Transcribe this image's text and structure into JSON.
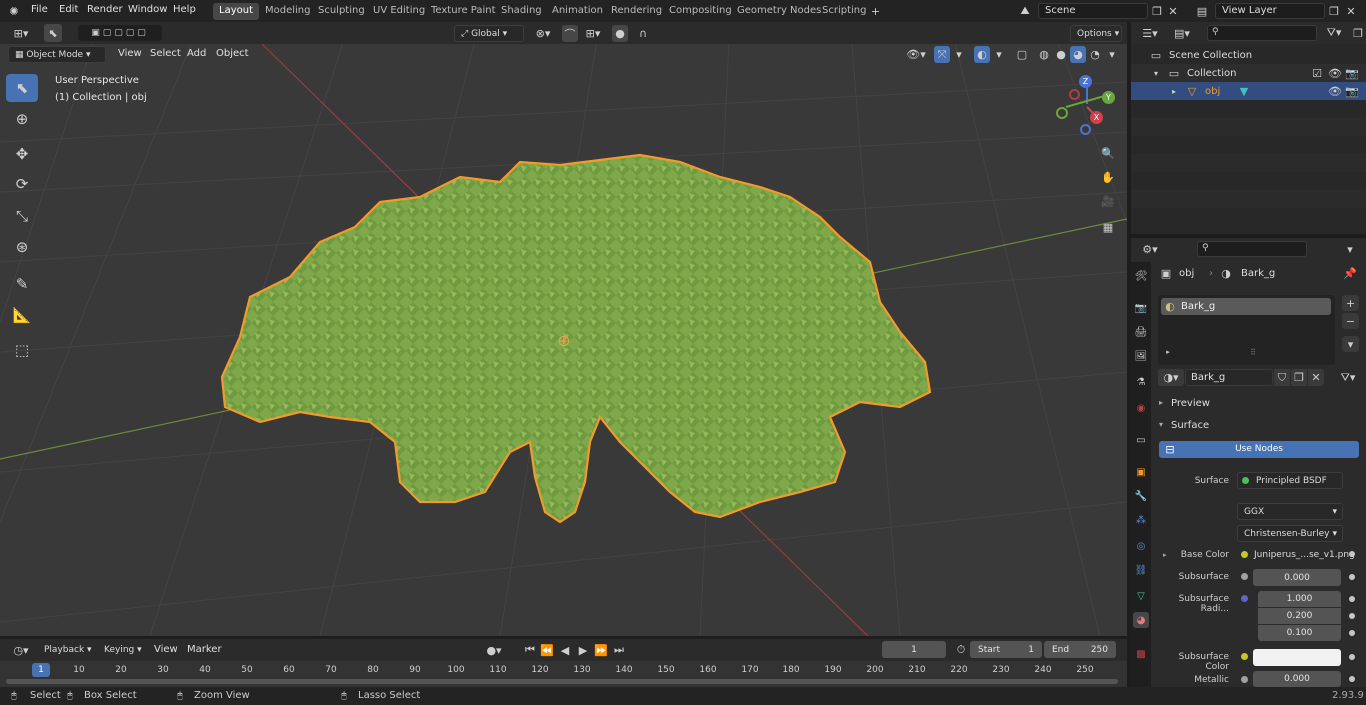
{
  "menu": [
    "File",
    "Edit",
    "Render",
    "Window",
    "Help"
  ],
  "workspaces": [
    "Layout",
    "Modeling",
    "Sculpting",
    "UV Editing",
    "Texture Paint",
    "Shading",
    "Animation",
    "Rendering",
    "Compositing",
    "Geometry Nodes",
    "Scripting"
  ],
  "scene": "Scene",
  "view_layer": "View Layer",
  "header": {
    "orientation": "Global",
    "options": "Options"
  },
  "viewport": {
    "mode": "Object Mode",
    "menus": [
      "View",
      "Select",
      "Add",
      "Object"
    ],
    "perspective": "User Perspective",
    "collection_info": "(1) Collection | obj",
    "axes": {
      "z": "Z",
      "y": "Y",
      "x": "X"
    }
  },
  "outliner": {
    "scene_collection": "Scene Collection",
    "collection": "Collection",
    "object": "obj"
  },
  "properties": {
    "breadcrumb_obj": "obj",
    "breadcrumb_mat": "Bark_g",
    "slot": "Bark_g",
    "material_name": "Bark_g",
    "panel_preview": "Preview",
    "panel_surface": "Surface",
    "use_nodes": "Use Nodes",
    "surface_label": "Surface",
    "surface_value": "Principled BSDF",
    "distribution": "GGX",
    "subsurface_method": "Christensen-Burley",
    "base_color_label": "Base Color",
    "base_color_value": "Juniperus_...se_v1.png",
    "subsurface_label": "Subsurface",
    "subsurface_value": "0.000",
    "subsurface_radius_label": "Subsurface Radi...",
    "subsurface_radius": [
      "1.000",
      "0.200",
      "0.100"
    ],
    "subsurface_color_label": "Subsurface Color",
    "metallic_label": "Metallic",
    "metallic_value": "0.000"
  },
  "timeline": {
    "menus": [
      "Playback",
      "Keying",
      "View",
      "Marker"
    ],
    "current_frame": "1",
    "start_label": "Start",
    "start": "1",
    "end_label": "End",
    "end": "250",
    "frames": [
      "1",
      "10",
      "20",
      "30",
      "40",
      "50",
      "60",
      "70",
      "80",
      "90",
      "100",
      "110",
      "120",
      "130",
      "140",
      "150",
      "160",
      "170",
      "180",
      "190",
      "200",
      "210",
      "220",
      "230",
      "240",
      "250"
    ]
  },
  "status": {
    "select": "Select",
    "box_select": "Box Select",
    "zoom": "Zoom View",
    "lasso": "Lasso Select",
    "version": "2.93.9"
  },
  "colors": {
    "accent": "#4772b3",
    "selection_outline": "#f39a2a",
    "foliage": "#7fa84a"
  }
}
